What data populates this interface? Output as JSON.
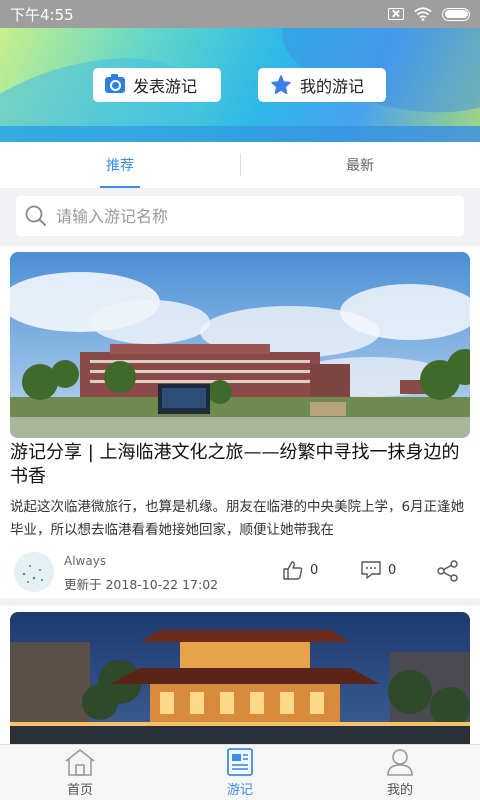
{
  "status_bar": {
    "time": "下午4:55",
    "icons": [
      "sim-icon",
      "wifi-icon",
      "battery-icon"
    ]
  },
  "banner": {
    "publish_label": "发表游记",
    "mine_label": "我的游记"
  },
  "tabs": [
    {
      "label": "推荐",
      "active": true
    },
    {
      "label": "最新",
      "active": false
    }
  ],
  "search": {
    "placeholder": "请输入游记名称"
  },
  "posts": [
    {
      "title": "游记分享 | 上海临港文化之旅——纷繁中寻找一抹身边的书香",
      "excerpt": "说起这次临港微旅行，也算是机缘。朋友在临港的中央美院上学，6月正逢她毕业，所以想去临港看看她接她回家，顺便让她带我在",
      "author": "Always",
      "updated": "更新于 2018-10-22 17:02",
      "likes": "0",
      "comments": "0"
    }
  ],
  "bottom_nav": [
    {
      "label": "首页",
      "icon": "home-icon",
      "active": false
    },
    {
      "label": "游记",
      "icon": "travel-notes-icon",
      "active": true
    },
    {
      "label": "我的",
      "icon": "profile-icon",
      "active": false
    }
  ],
  "colors": {
    "accent": "#3a8ee6",
    "status_bar": "#9e9e9e"
  }
}
